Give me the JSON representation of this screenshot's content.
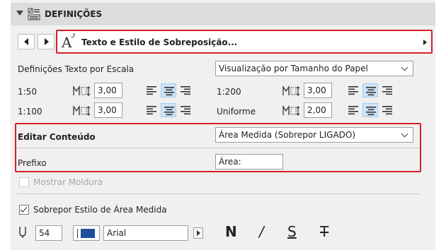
{
  "header": {
    "title": "DEFINIÇÕES"
  },
  "nav": {
    "selector_label": "Texto e Estilo de Sobreposição..."
  },
  "scale_section": {
    "label": "Definições Texto por Escala",
    "display_mode": "Visualização por Tamanho do Papel",
    "rows": [
      {
        "label": "1:50",
        "value": "3,00"
      },
      {
        "label": "1:100",
        "value": "3,00"
      },
      {
        "label": "1:200",
        "value": "3,00"
      },
      {
        "label": "Uniforme",
        "value": "2,00"
      }
    ]
  },
  "edit_content": {
    "label": "Editar Conteúdo",
    "value": "Área Medida (Sobrepor LIGADO)",
    "prefix_label": "Prefixo",
    "prefix_value": "Área:"
  },
  "frame": {
    "label": "Mostrar Moldura",
    "checked": false,
    "enabled": false
  },
  "override": {
    "label": "Sobrepor Estilo de Área Medida",
    "checked": true
  },
  "font_row": {
    "size": "54",
    "color": "#1f4e9a",
    "font_name": "Arial",
    "bold_label": "N",
    "italic_label": "/",
    "underline_label": "S",
    "strike_label": "T"
  },
  "colors": {
    "highlight_border": "#d61f2a",
    "selected_align_bg": "#cfe3f7"
  }
}
